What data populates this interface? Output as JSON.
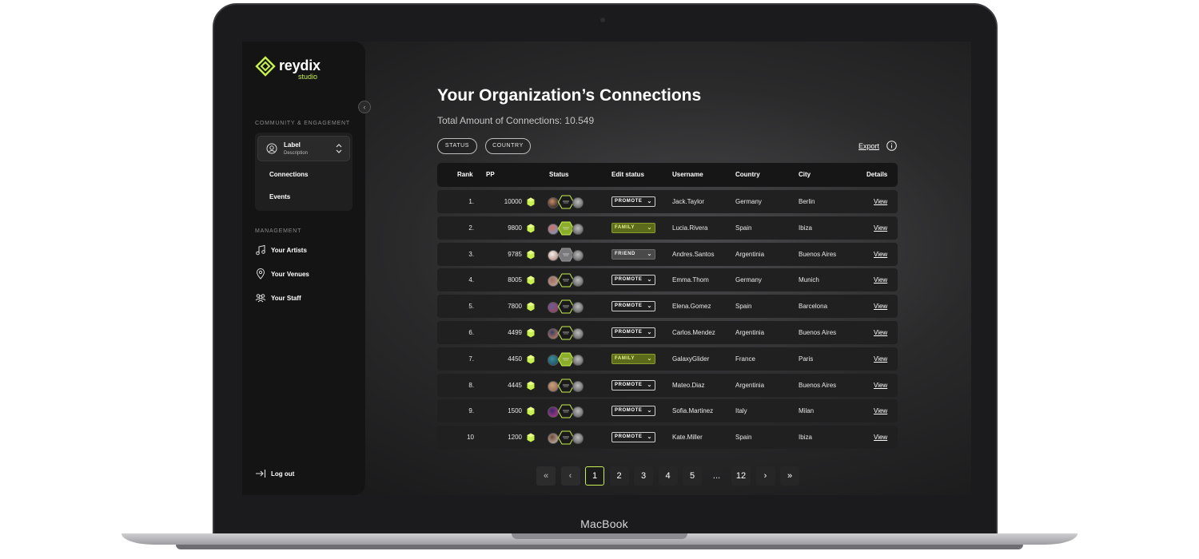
{
  "device": {
    "label": "MacBook"
  },
  "brand": {
    "name": "reydix",
    "sub": "studio",
    "accent": "#c7f050"
  },
  "sidebar": {
    "section_community": "COMMUNITY & ENGAGEMENT",
    "selector": {
      "label": "Label",
      "description": "Description"
    },
    "sub_items": [
      {
        "label": "Connections"
      },
      {
        "label": "Events"
      }
    ],
    "section_management": "MANAGEMENT",
    "nav": [
      {
        "label": "Your Artists",
        "icon": "music-note-icon"
      },
      {
        "label": "Your Venues",
        "icon": "location-pin-icon"
      },
      {
        "label": "Your Staff",
        "icon": "people-icon"
      }
    ],
    "logout": "Log out"
  },
  "main": {
    "title": "Your Organization’s Connections",
    "total_label": "Total Amount of Connections: 10.549",
    "filters": [
      {
        "label": "STATUS"
      },
      {
        "label": "COUNTRY"
      }
    ],
    "export": "Export"
  },
  "table": {
    "headers": {
      "rank": "Rank",
      "pp": "PP",
      "status": "Status",
      "edit_status": "Edit status",
      "username": "Username",
      "country": "Country",
      "city": "City",
      "details": "Details"
    },
    "view_label": "View",
    "rows": [
      {
        "rank": "1.",
        "pp": "10000",
        "badge": "PROMOTE",
        "username": "Jack.Taylor",
        "country": "Germany",
        "city": "Berlin"
      },
      {
        "rank": "2.",
        "pp": "9800",
        "badge": "FAMILY",
        "username": "Lucia.Rivera",
        "country": "Spain",
        "city": "Ibiza"
      },
      {
        "rank": "3.",
        "pp": "9785",
        "badge": "FRIEND",
        "username": "Andres.Santos",
        "country": "Argentinia",
        "city": "Buenos Aires"
      },
      {
        "rank": "4.",
        "pp": "8005",
        "badge": "PROMOTE",
        "username": "Emma.Thom",
        "country": "Germany",
        "city": "Munich"
      },
      {
        "rank": "5.",
        "pp": "7800",
        "badge": "PROMOTE",
        "username": "Elena.Gomez",
        "country": "Spain",
        "city": "Barcelona"
      },
      {
        "rank": "6.",
        "pp": "4499",
        "badge": "PROMOTE",
        "username": "Carlos.Mendez",
        "country": "Argentinia",
        "city": "Buenos Aires"
      },
      {
        "rank": "7.",
        "pp": "4450",
        "badge": "FAMILY",
        "username": "GalaxyGlider",
        "country": "France",
        "city": "Paris"
      },
      {
        "rank": "8.",
        "pp": "4445",
        "badge": "PROMOTE",
        "username": "Mateo.Diaz",
        "country": "Argentinia",
        "city": "Buenos Aires"
      },
      {
        "rank": "9.",
        "pp": "1500",
        "badge": "PROMOTE",
        "username": "Sofia.Martinez",
        "country": "Italy",
        "city": "Milan"
      },
      {
        "rank": "10",
        "pp": "1200",
        "badge": "PROMOTE",
        "username": "Kate.Miller",
        "country": "Spain",
        "city": "Ibiza"
      }
    ]
  },
  "pagination": {
    "first": "«",
    "prev": "‹",
    "pages": [
      "1",
      "2",
      "3",
      "4",
      "5"
    ],
    "ellipsis": "...",
    "last_page": "12",
    "next": "›",
    "last": "»",
    "current": "1"
  }
}
